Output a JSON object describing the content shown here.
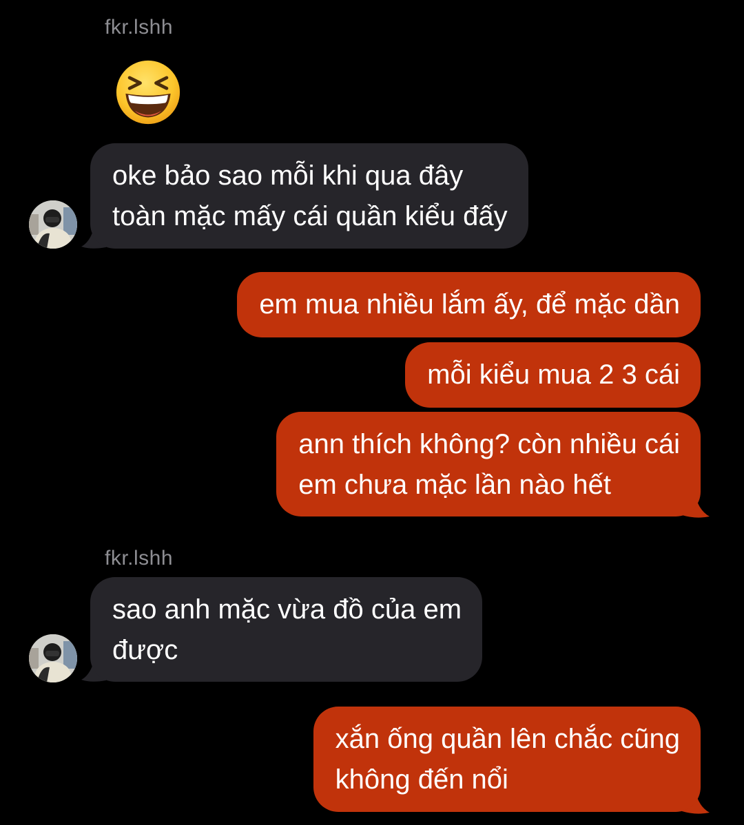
{
  "conversation": {
    "sender_name": "fkr.lshh",
    "emoji": "laughing-squinting-face",
    "colors": {
      "incoming_bubble": "#26252a",
      "outgoing_bubble": "#c1330b",
      "sender_name": "#8e8e93",
      "background": "#000000"
    },
    "messages": [
      {
        "from": "them",
        "lines": [
          "oke bảo sao mỗi khi qua đây",
          "toàn mặc mấy cái quần kiểu đấy"
        ]
      },
      {
        "from": "me",
        "lines": [
          "em mua nhiều lắm ấy, để mặc dần"
        ]
      },
      {
        "from": "me",
        "lines": [
          "mỗi kiểu mua 2 3 cái"
        ]
      },
      {
        "from": "me",
        "lines": [
          "ann thích không? còn nhiều cái",
          "em chưa mặc lần nào hết"
        ]
      },
      {
        "from": "them",
        "lines": [
          "sao anh mặc vừa đồ của em",
          "được"
        ]
      },
      {
        "from": "me",
        "lines": [
          "xắn ống quần lên chắc cũng",
          "không đến nổi"
        ]
      }
    ]
  }
}
